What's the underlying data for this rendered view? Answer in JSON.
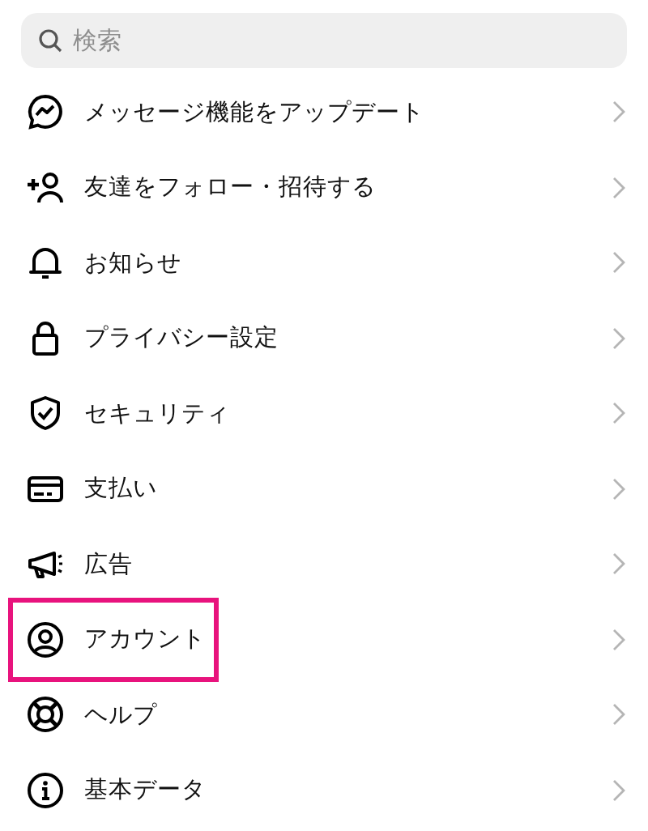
{
  "search": {
    "placeholder": "検索"
  },
  "items": [
    {
      "kind": "messenger",
      "label": "メッセージ機能をアップデート",
      "highlighted": false
    },
    {
      "kind": "add-person",
      "label": "友達をフォロー・招待する",
      "highlighted": false
    },
    {
      "kind": "bell",
      "label": "お知らせ",
      "highlighted": false
    },
    {
      "kind": "lock",
      "label": "プライバシー設定",
      "highlighted": false
    },
    {
      "kind": "shield",
      "label": "セキュリティ",
      "highlighted": false
    },
    {
      "kind": "card",
      "label": "支払い",
      "highlighted": false
    },
    {
      "kind": "megaphone",
      "label": "広告",
      "highlighted": false
    },
    {
      "kind": "account",
      "label": "アカウント",
      "highlighted": true
    },
    {
      "kind": "lifebuoy",
      "label": "ヘルプ",
      "highlighted": false
    },
    {
      "kind": "info",
      "label": "基本データ",
      "highlighted": false
    }
  ]
}
